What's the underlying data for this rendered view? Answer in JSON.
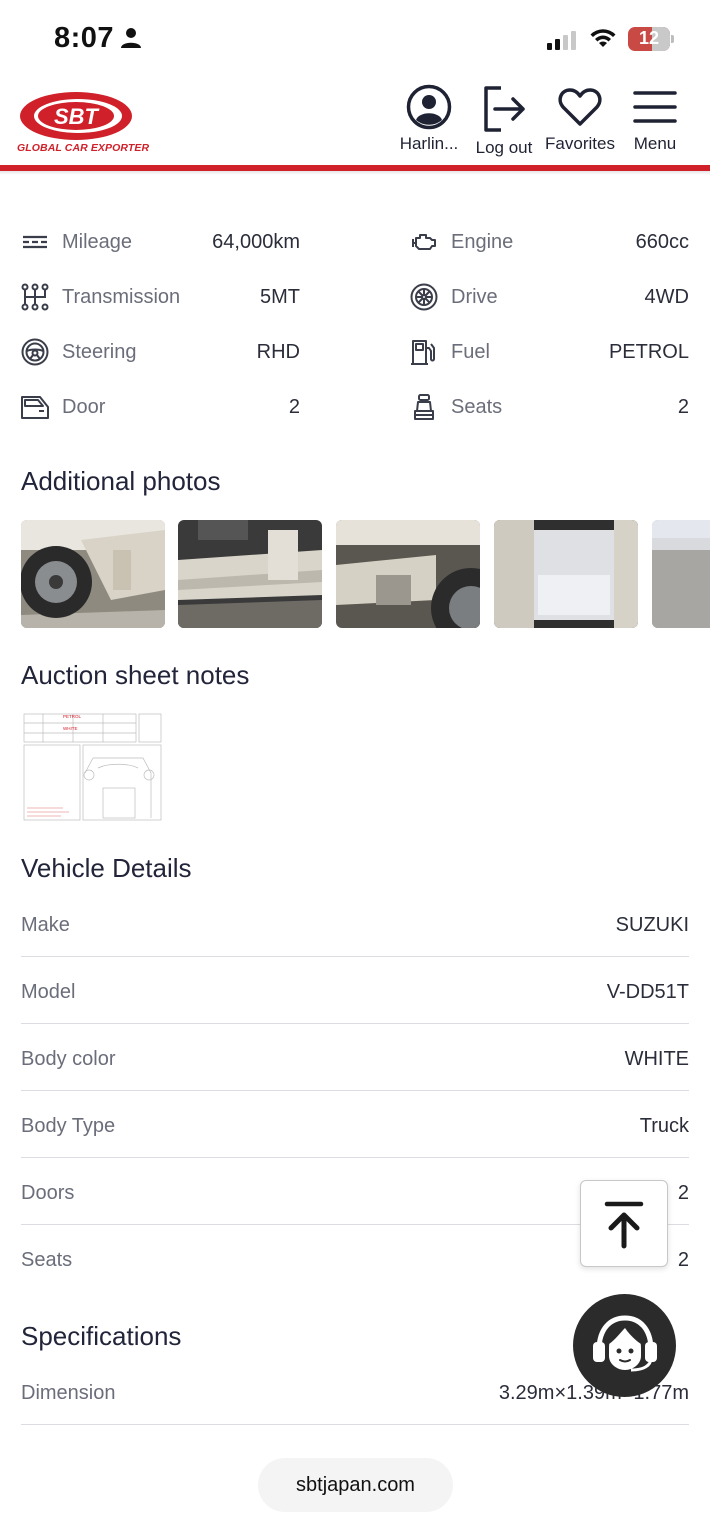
{
  "status_bar": {
    "time": "8:07",
    "battery": "12"
  },
  "header": {
    "logo_text": "SBT",
    "logo_tagline": "GLOBAL CAR EXPORTER",
    "nav": [
      {
        "label": "Harlin...",
        "icon": "user-circle-icon"
      },
      {
        "label": "Log out",
        "icon": "logout-icon"
      },
      {
        "label": "Favorites",
        "icon": "heart-icon"
      },
      {
        "label": "Menu",
        "icon": "hamburger-menu-icon"
      }
    ]
  },
  "specs": [
    {
      "label": "Mileage",
      "value": "64,000km",
      "icon": "odometer-icon"
    },
    {
      "label": "Engine",
      "value": "660cc",
      "icon": "engine-icon"
    },
    {
      "label": "Transmission",
      "value": "5MT",
      "icon": "gearshift-icon"
    },
    {
      "label": "Drive",
      "value": "4WD",
      "icon": "wheel-icon"
    },
    {
      "label": "Steering",
      "value": "RHD",
      "icon": "steering-wheel-icon"
    },
    {
      "label": "Fuel",
      "value": "PETROL",
      "icon": "fuel-pump-icon"
    },
    {
      "label": "Door",
      "value": "2",
      "icon": "car-door-icon"
    },
    {
      "label": "Seats",
      "value": "2",
      "icon": "seat-icon"
    }
  ],
  "sections": {
    "photos_title": "Additional photos",
    "auction_title": "Auction sheet notes",
    "details_title": "Vehicle Details",
    "specifications_title": "Specifications"
  },
  "auction_sheet": {
    "fuel": "PETROL",
    "color": "WHITE"
  },
  "vehicle_details": [
    {
      "label": "Make",
      "value": "SUZUKI"
    },
    {
      "label": "Model",
      "value": "V-DD51T"
    },
    {
      "label": "Body color",
      "value": "WHITE"
    },
    {
      "label": "Body Type",
      "value": "Truck"
    },
    {
      "label": "Doors",
      "value": "2"
    },
    {
      "label": "Seats",
      "value": "2"
    }
  ],
  "specifications": [
    {
      "label": "Dimension",
      "value": "3.29m×1.39m×1.77m"
    }
  ],
  "browser": {
    "url": "sbtjapan.com"
  },
  "colors": {
    "brand_red": "#d0202a",
    "text_dark": "#2b2e3a",
    "text_muted": "#6b6e7a"
  }
}
